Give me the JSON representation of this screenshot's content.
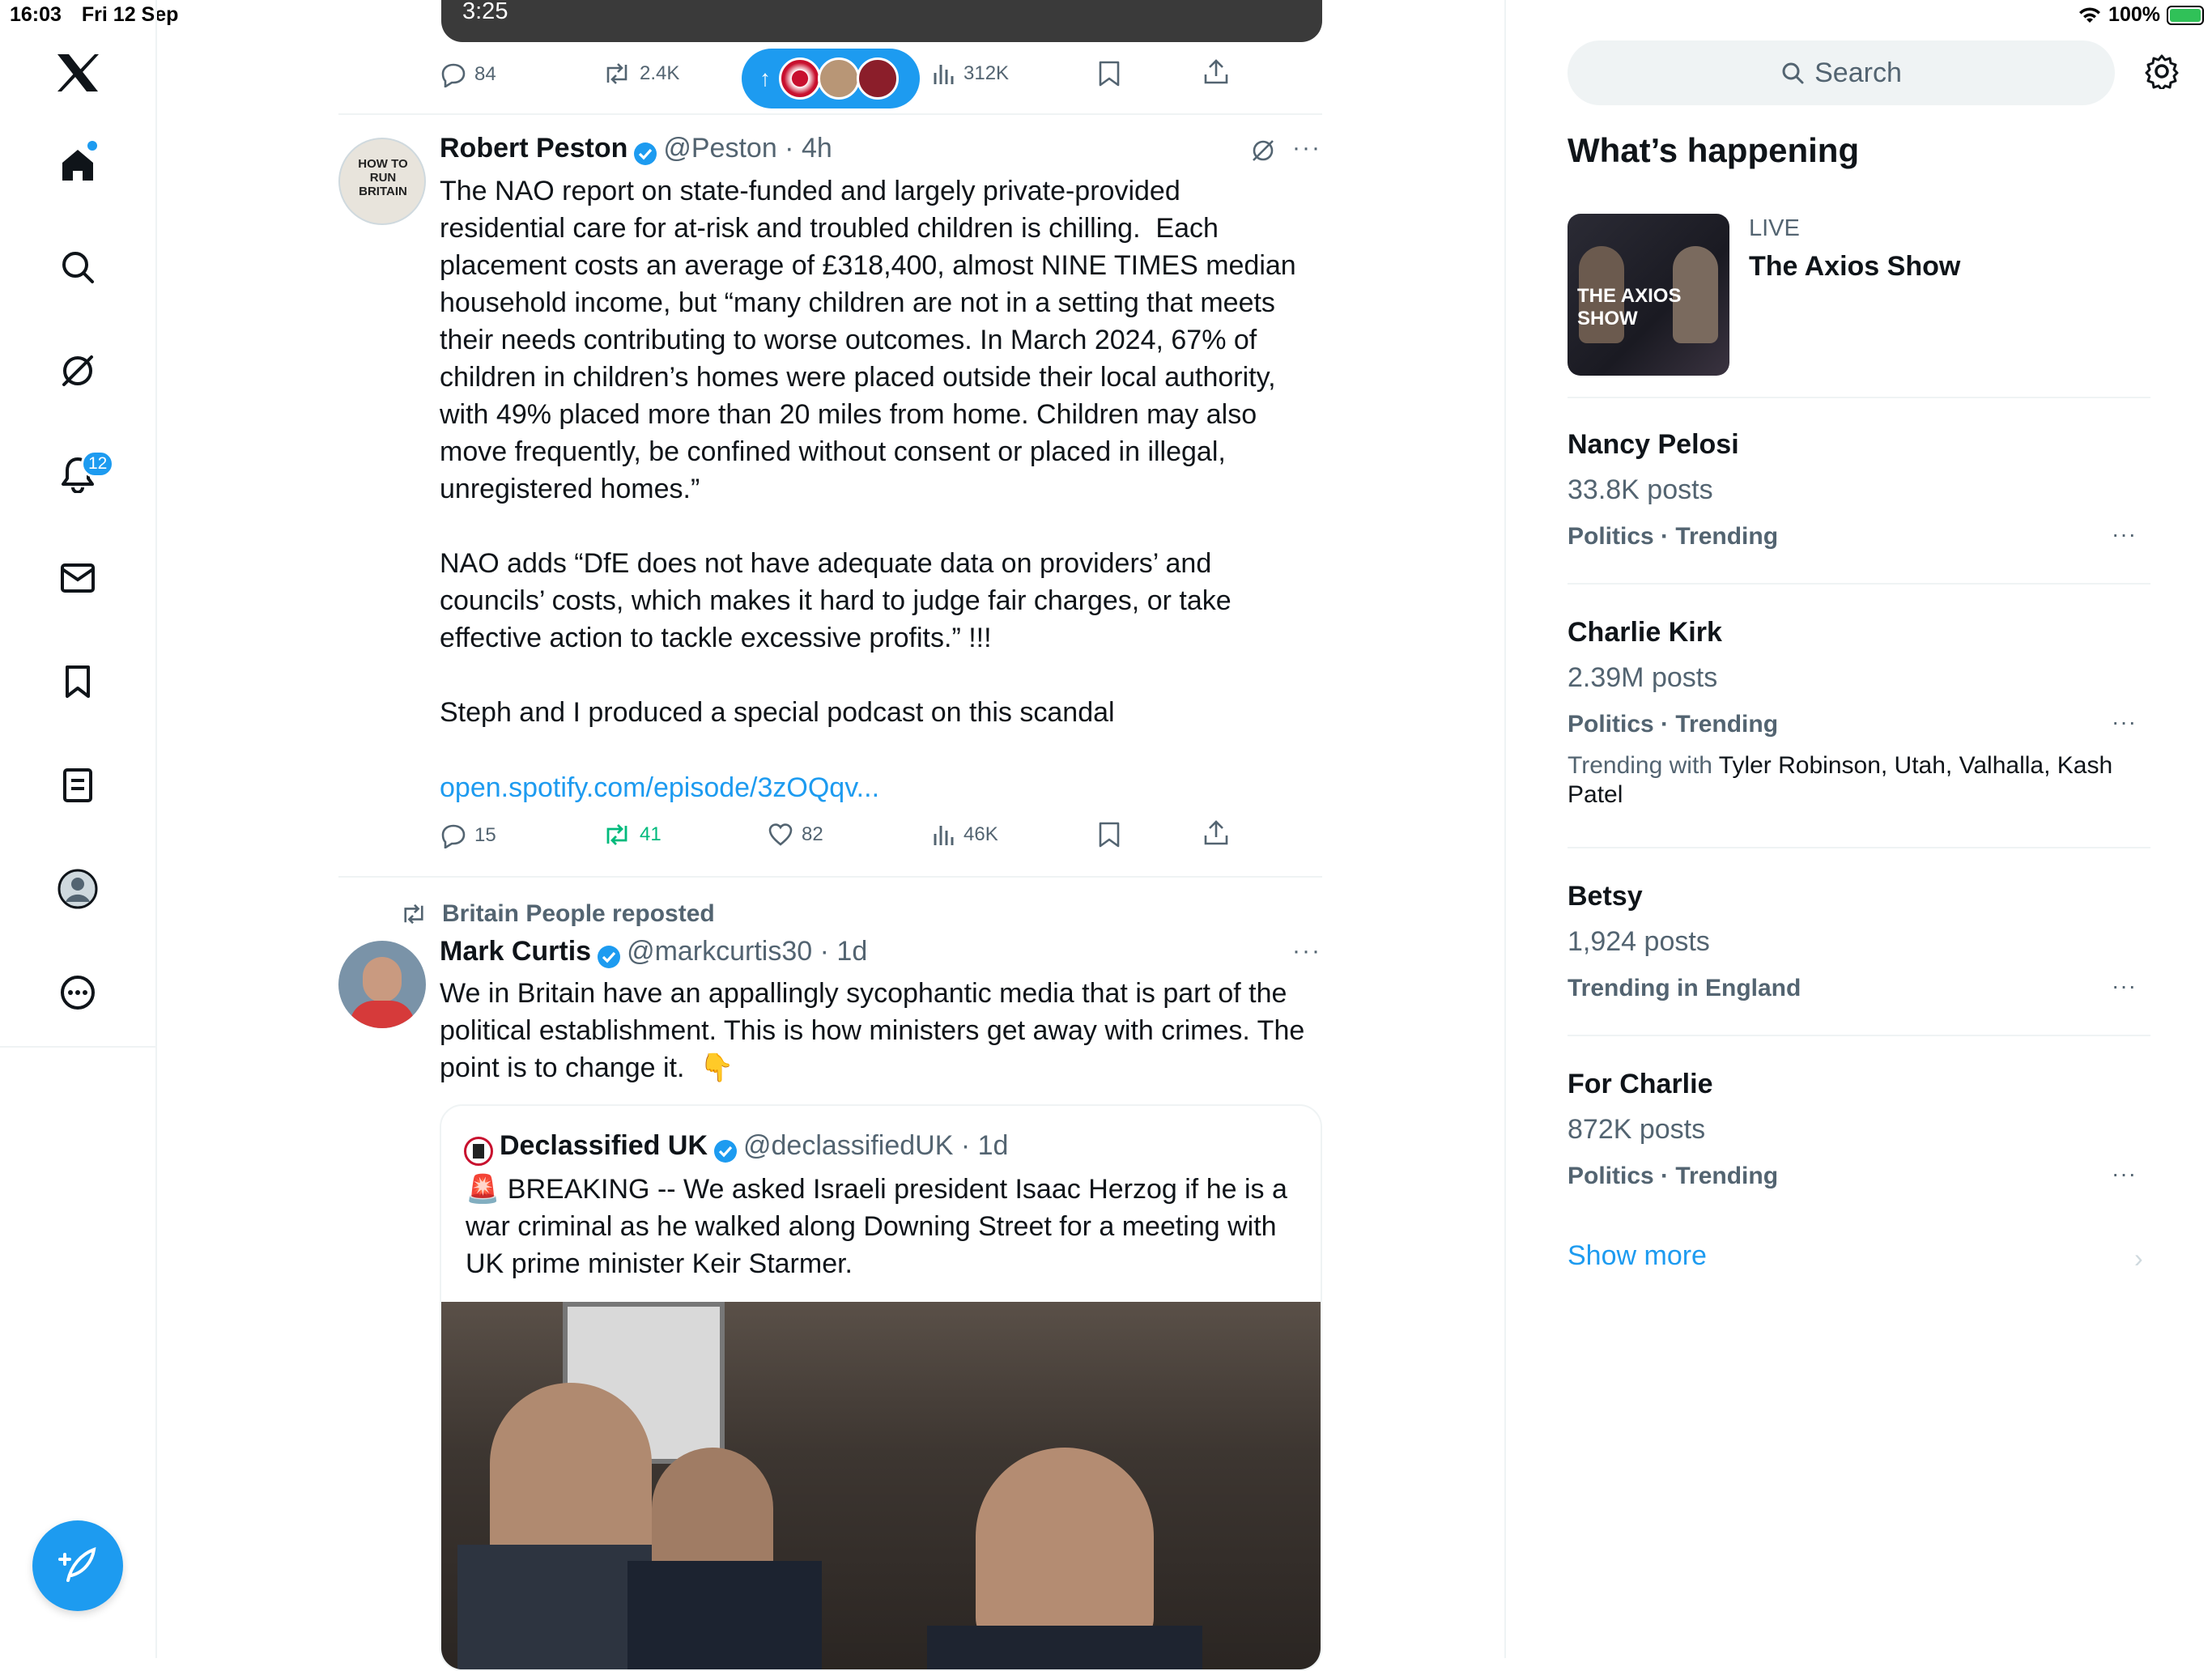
{
  "status": {
    "time": "16:03",
    "date": "Fri 12 Sep",
    "battery": "100%"
  },
  "nav": {
    "items": [
      "x-logo",
      "home",
      "search",
      "grok",
      "notifications",
      "messages",
      "bookmarks",
      "lists",
      "profile",
      "more"
    ],
    "notifications_badge": "12"
  },
  "video": {
    "time": "3:25"
  },
  "prev_actions": {
    "replies": "84",
    "reposts": "2.4K",
    "views": "312K"
  },
  "tweet1": {
    "name": "Robert Peston",
    "handle": "@Peston",
    "time": "4h",
    "text": "The NAO report on state-funded and largely private-provided\nresidential care for at-risk and troubled children is chilling.  Each\nplacement costs an average of £318,400, almost NINE TIMES median\nhousehold income, but “many children are not in a setting that meets\ntheir needs contributing to worse outcomes. In March 2024, 67% of\nchildren in children’s homes were placed outside their local authority,\nwith 49% placed more than 20 miles from home. Children may also\nmove frequently, be confined without consent or placed in illegal,\nunregistered homes.”\n\nNAO adds “DfE does not have adequate data on providers’ and\ncouncils’ costs, which makes it hard to judge fair charges, or take\neffective action to tackle excessive profits.” !!!\n\nSteph and I produced a special podcast on this scandal",
    "link": "open.spotify.com/episode/3zOQqv...",
    "replies": "15",
    "reposts": "41",
    "likes": "82",
    "views": "46K",
    "avatar_text": "HOW TO RUN BRITAIN"
  },
  "tweet2": {
    "reposted_by": "Britain People reposted",
    "name": "Mark Curtis",
    "handle": "@markcurtis30",
    "time": "1d",
    "text": "We in Britain have an appallingly sycophantic media that is part of the\npolitical establishment. This is how ministers get away with crimes. The\npoint is to change it.  👇",
    "quote": {
      "name": "Declassified UK",
      "handle": "@declassifiedUK",
      "time": "1d",
      "text": "🚨 BREAKING -- We asked Israeli president Isaac Herzog if he is a\nwar criminal as he walked along Downing Street for a meeting with\nUK prime minister Keir Starmer."
    }
  },
  "sidebar": {
    "search_placeholder": "Search",
    "title": "What’s happening",
    "live": {
      "label": "LIVE",
      "title": "The Axios Show",
      "thumb_text": "THE AXIOS SHOW"
    },
    "trends": [
      {
        "title": "Nancy Pelosi",
        "posts": "33.8K posts",
        "category": "Politics · Trending"
      },
      {
        "title": "Charlie Kirk",
        "posts": "2.39M posts",
        "category": "Politics · Trending",
        "with_label": "Trending with",
        "with_names": "Tyler Robinson, Utah, Valhalla, Kash Patel"
      },
      {
        "title": "Betsy",
        "posts": "1,924 posts",
        "category": "Trending in England"
      },
      {
        "title": "For Charlie",
        "posts": "872K posts",
        "category": "Politics · Trending"
      }
    ],
    "show_more": "Show more"
  },
  "colors": {
    "accent": "#1d9bf0",
    "repost_green": "#00ba7c",
    "muted": "#536471"
  }
}
